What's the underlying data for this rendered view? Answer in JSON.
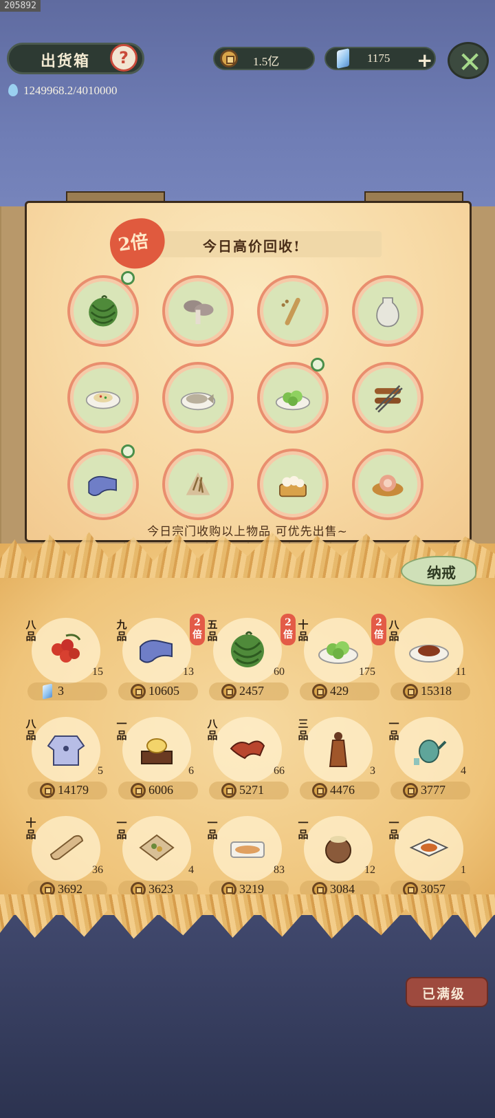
{
  "corner_id": "205892",
  "header": {
    "title": "出货箱",
    "help_icon": "question-mark-icon",
    "water": "1249968.2/4010000",
    "coins": "1.5亿",
    "gems": "1175",
    "plus": "+",
    "close_icon": "close-icon"
  },
  "banner": {
    "badge": "2倍",
    "title": "今日高价回收!",
    "note": "今日宗门收购以上物品,可优先出售~",
    "items": [
      {
        "icon": "watermelon",
        "ring": true
      },
      {
        "icon": "mushroom",
        "ring": false
      },
      {
        "icon": "root",
        "ring": false
      },
      {
        "icon": "vase",
        "ring": false
      },
      {
        "icon": "noodle-plate",
        "ring": false
      },
      {
        "icon": "fish-plate",
        "ring": false
      },
      {
        "icon": "greens-plate",
        "ring": true
      },
      {
        "icon": "grilled-skewers",
        "ring": false
      },
      {
        "icon": "cloth",
        "ring": true
      },
      {
        "icon": "herb-bundle",
        "ring": false
      },
      {
        "icon": "steamed-buns",
        "ring": false
      },
      {
        "icon": "meat-bowl",
        "ring": false
      }
    ]
  },
  "storage_tab": "纳戒",
  "inventory": [
    {
      "grade": "八品",
      "icon": "lychee",
      "qty": "15",
      "price": "3",
      "currency": "gem",
      "double": ""
    },
    {
      "grade": "九品",
      "icon": "cloth",
      "qty": "13",
      "price": "10605",
      "currency": "coin",
      "double": "2倍"
    },
    {
      "grade": "五品",
      "icon": "watermelon",
      "qty": "60",
      "price": "2457",
      "currency": "coin",
      "double": "2倍"
    },
    {
      "grade": "十品",
      "icon": "greens-plate",
      "qty": "175",
      "price": "429",
      "currency": "coin",
      "double": "2倍"
    },
    {
      "grade": "八品",
      "icon": "braised-dish",
      "qty": "11",
      "price": "15318",
      "currency": "coin",
      "double": ""
    },
    {
      "grade": "八品",
      "icon": "robe",
      "qty": "5",
      "price": "14179",
      "currency": "coin",
      "double": ""
    },
    {
      "grade": "一品",
      "icon": "ingot-box",
      "qty": "6",
      "price": "6006",
      "currency": "coin",
      "double": ""
    },
    {
      "grade": "八品",
      "icon": "red-cloth",
      "qty": "66",
      "price": "5271",
      "currency": "coin",
      "double": ""
    },
    {
      "grade": "三品",
      "icon": "statue",
      "qty": "3",
      "price": "4476",
      "currency": "coin",
      "double": ""
    },
    {
      "grade": "一品",
      "icon": "teapot",
      "qty": "4",
      "price": "3777",
      "currency": "coin",
      "double": ""
    },
    {
      "grade": "十品",
      "icon": "scroll",
      "qty": "36",
      "price": "3692",
      "currency": "coin",
      "double": ""
    },
    {
      "grade": "一品",
      "icon": "herb-pack",
      "qty": "4",
      "price": "3623",
      "currency": "coin",
      "double": ""
    },
    {
      "grade": "一品",
      "icon": "fish-platter",
      "qty": "83",
      "price": "3219",
      "currency": "coin",
      "double": ""
    },
    {
      "grade": "一品",
      "icon": "clay-pot",
      "qty": "12",
      "price": "3084",
      "currency": "coin",
      "double": ""
    },
    {
      "grade": "一品",
      "icon": "tofu-dish",
      "qty": "1",
      "price": "3057",
      "currency": "coin",
      "double": ""
    }
  ],
  "footer": {
    "maxed": "已满级"
  }
}
